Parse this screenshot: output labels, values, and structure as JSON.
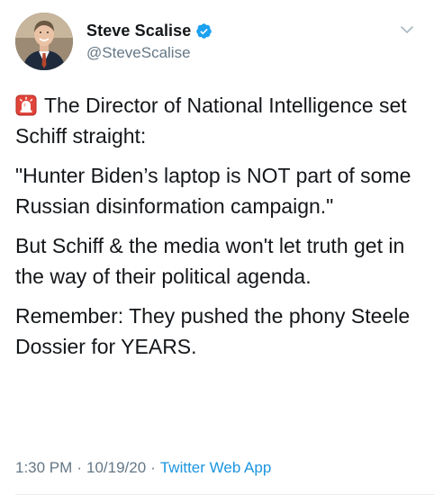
{
  "author": {
    "display_name": "Steve Scalise",
    "handle": "@SteveScalise",
    "verified": true,
    "avatar_icon": "profile-photo"
  },
  "tweet": {
    "lead_emoji": "siren-icon",
    "paragraphs": [
      "The Director of National Intelligence set Schiff straight:",
      "\"Hunter Biden’s laptop is NOT part of some Russian disinformation campaign.\"",
      "But Schiff & the media won't let truth get in the way of their political agenda.",
      "Remember: They pushed the phony Steele Dossier for YEARS."
    ]
  },
  "meta": {
    "time": "1:30 PM",
    "separator": "·",
    "date": "10/19/20",
    "source": "Twitter Web App"
  },
  "colors": {
    "text": "#14171a",
    "muted": "#657786",
    "link": "#1b95e0",
    "verified": "#1da1f2"
  }
}
